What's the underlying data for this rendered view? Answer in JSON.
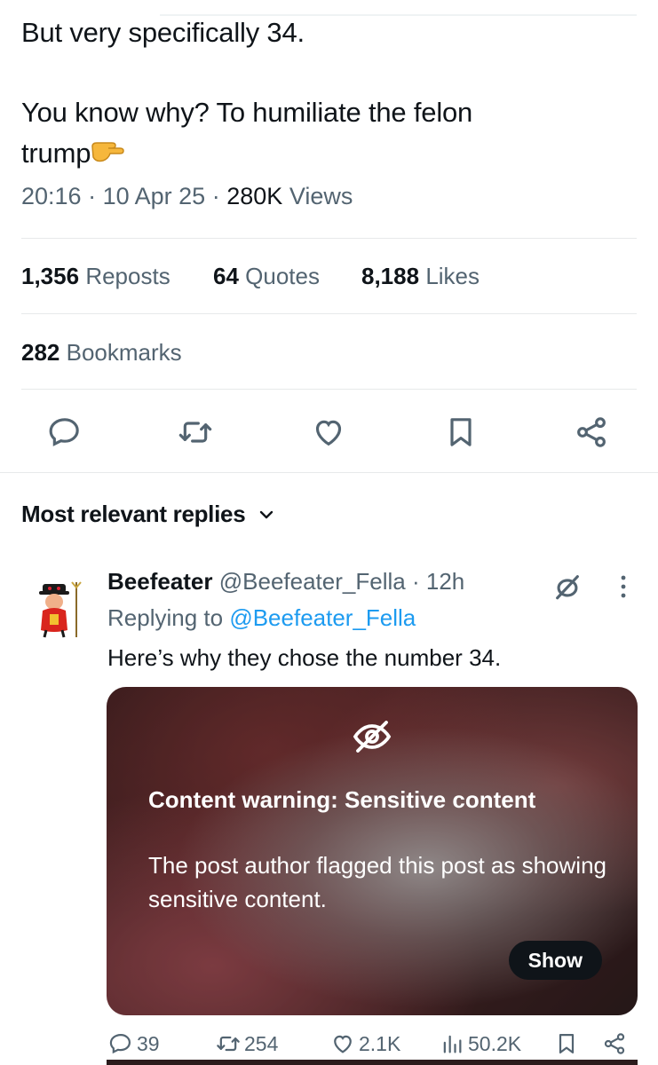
{
  "post": {
    "text_line1": "But very specifically 34.",
    "text_line2": "You know why?  To humiliate the felon",
    "text_line3": "trump",
    "pointing_emoji": "👉",
    "time": "20:16",
    "date": "10 Apr 25",
    "views_count": "280K",
    "views_label": "Views",
    "sep": "·"
  },
  "stats": {
    "reposts_count": "1,356",
    "reposts_label": "Reposts",
    "quotes_count": "64",
    "quotes_label": "Quotes",
    "likes_count": "8,188",
    "likes_label": "Likes",
    "bookmarks_count": "282",
    "bookmarks_label": "Bookmarks"
  },
  "actions": {
    "icons": [
      "reply-icon",
      "repost-icon",
      "like-icon",
      "bookmark-icon",
      "share-icon"
    ]
  },
  "replies": {
    "heading": "Most relevant replies",
    "reply": {
      "name": "Beefeater",
      "handle": "@Beefeater_Fella",
      "time": "12h",
      "replying_to_label": "Replying to",
      "replying_to_handle": "@Beefeater_Fella",
      "text": "Here’s why they chose the number 34.",
      "warning_title": "Content warning: Sensitive content",
      "warning_body": "The post author flagged this post as showing sensitive content.",
      "show_label": "Show",
      "reply_count": "39",
      "repost_count": "254",
      "like_count": "2.1K",
      "views_count": "50.2K"
    }
  },
  "colors": {
    "accent": "#1d9bf0",
    "muted": "#536471",
    "text": "#0f1419"
  }
}
